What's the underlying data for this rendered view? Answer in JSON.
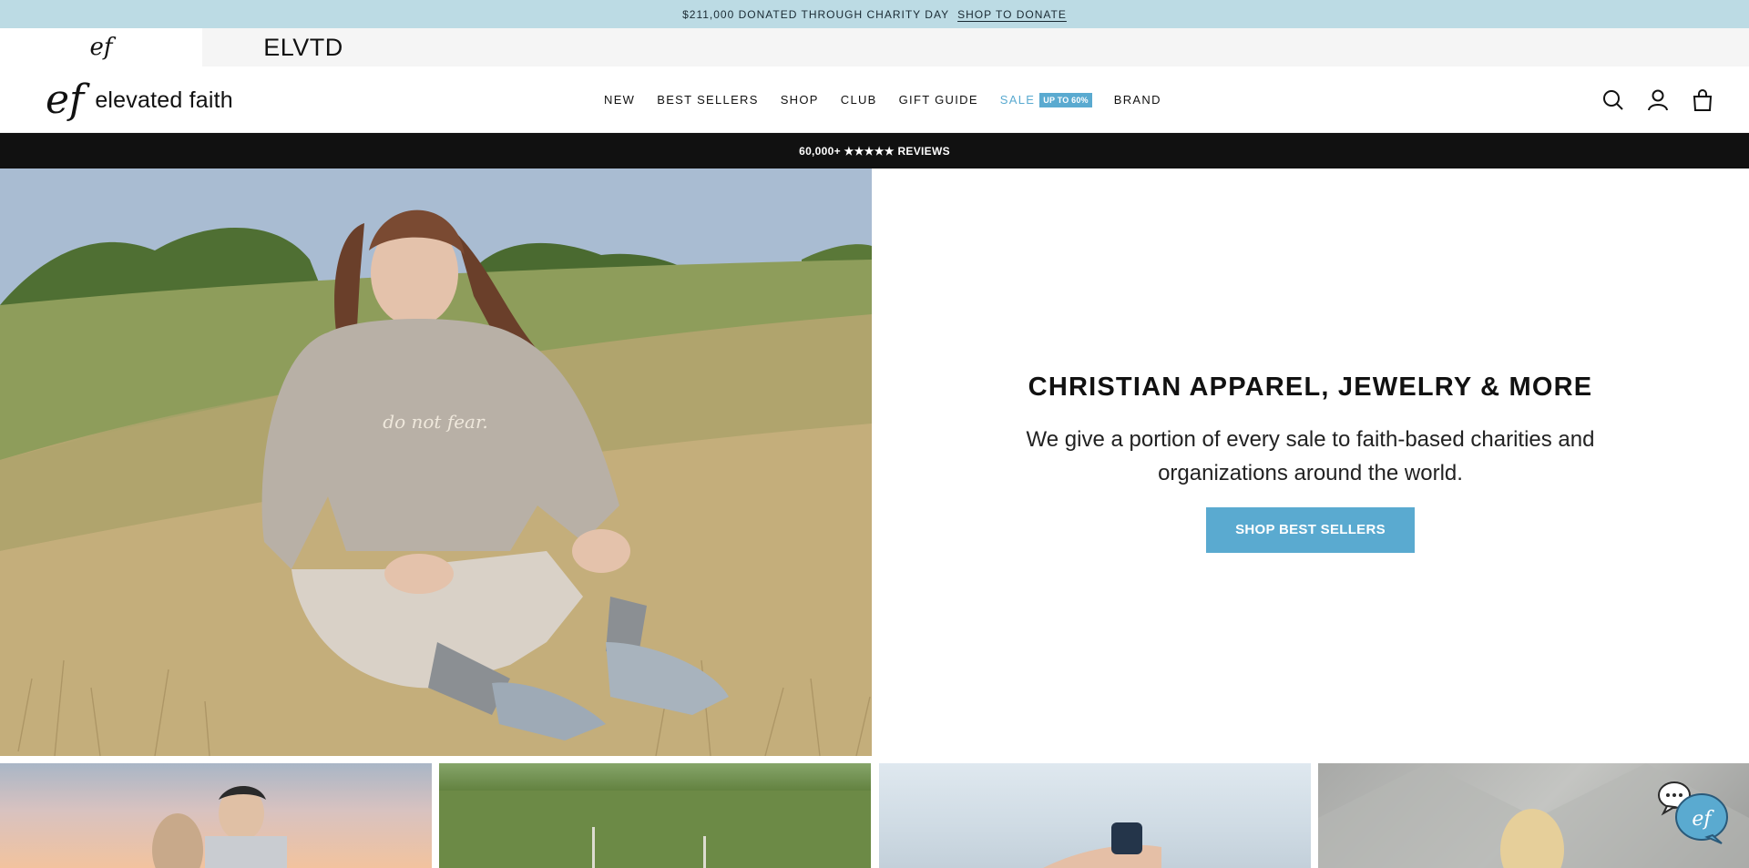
{
  "announcement": {
    "message": "$211,000  DONATED THROUGH CHARITY DAY",
    "link": "SHOP TO DONATE"
  },
  "brand_switcher": {
    "ef_tab": "ef",
    "elvtd_tab": "ELVTD"
  },
  "header": {
    "logo_mono": "ef",
    "logo_word": "elevated faith",
    "nav": [
      {
        "label": "NEW"
      },
      {
        "label": "BEST SELLERS"
      },
      {
        "label": "SHOP"
      },
      {
        "label": "CLUB"
      },
      {
        "label": "GIFT GUIDE"
      },
      {
        "label": "SALE",
        "badge": "UP TO 60%"
      },
      {
        "label": "BRAND"
      }
    ],
    "icons": [
      "search-icon",
      "account-icon",
      "cart-icon"
    ]
  },
  "reviews_strip": {
    "text": "60,000+ ★★★★★ REVIEWS"
  },
  "hero": {
    "hoodie_text": "do not fear.",
    "title": "CHRISTIAN APPAREL, JEWELRY & MORE",
    "subtitle": "We give a portion of every sale to faith-based charities and organizations around the world.",
    "cta": "SHOP BEST SELLERS"
  },
  "chat_widget": {
    "mono": "ef"
  },
  "colors": {
    "announcement_bg": "#bcdbe4",
    "accent": "#5aaad0",
    "reviews_bg": "#111111"
  }
}
